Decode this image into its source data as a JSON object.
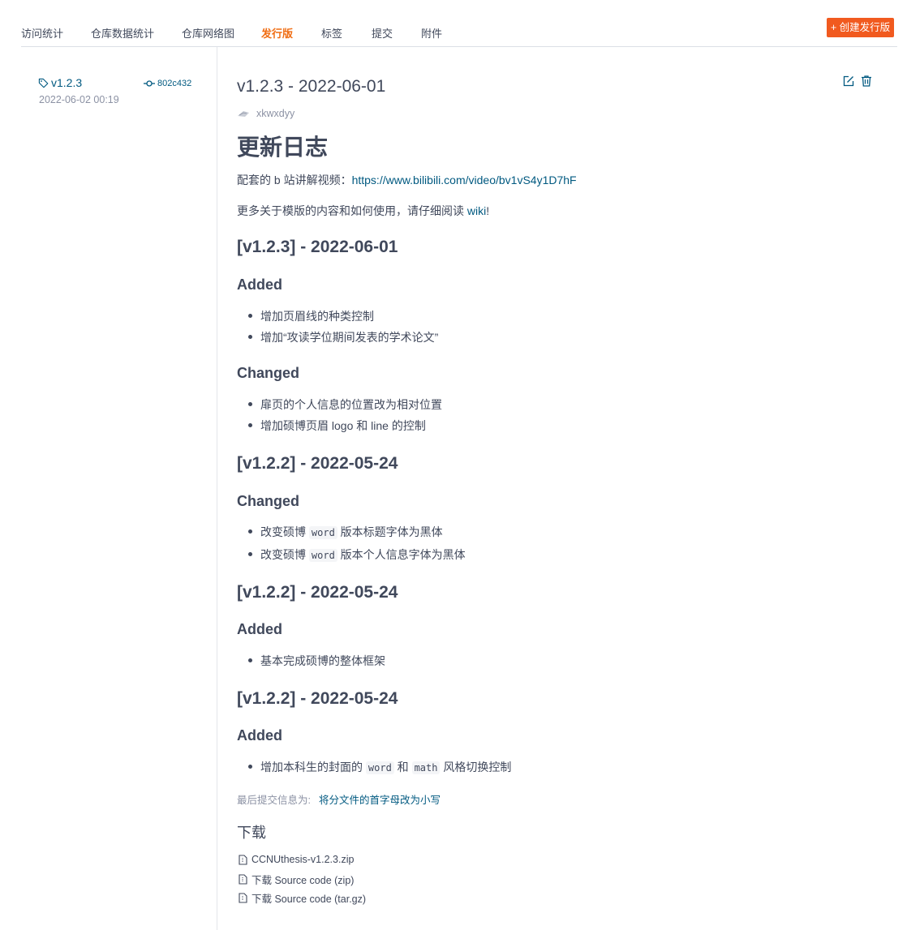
{
  "nav": {
    "tabs": [
      {
        "label": "访问统计"
      },
      {
        "label": "仓库数据统计"
      },
      {
        "label": "仓库网络图"
      },
      {
        "label": "发行版"
      },
      {
        "label": "标签"
      },
      {
        "label": "提交"
      },
      {
        "label": "附件"
      }
    ],
    "active_tab": "发行版",
    "create_button": "+ 创建发行版"
  },
  "sidebar": {
    "tag": "v1.2.3",
    "commit": "802c432",
    "date": "2022-06-02 00:19"
  },
  "release": {
    "title": "v1.2.3 - 2022-06-01",
    "author": "xkwxdyy",
    "heading": "更新日志",
    "video_prefix": "配套的 b 站讲解视频：",
    "video_link": "https://www.bilibili.com/video/bv1vS4y1D7hF",
    "wiki_prefix": "更多关于模版的内容和如何使用，请仔细阅读 ",
    "wiki_link": "wiki",
    "wiki_suffix": "!",
    "sections": [
      {
        "version": "[v1.2.3] - 2022-06-01",
        "groups": [
          {
            "name": "Added",
            "items": [
              "增加页眉线的种类控制",
              "增加“攻读学位期间发表的学术论文”"
            ]
          },
          {
            "name": "Changed",
            "items": [
              "扉页的个人信息的位置改为相对位置",
              "增加硕博页眉 logo 和 line 的控制"
            ]
          }
        ]
      },
      {
        "version": "[v1.2.2] - 2022-05-24",
        "groups": [
          {
            "name": "Changed",
            "items": [
              {
                "pre": "改变硕博 ",
                "code": "word",
                "post": " 版本标题字体为黑体"
              },
              {
                "pre": "改变硕博 ",
                "code": "word",
                "post": " 版本个人信息字体为黑体"
              }
            ]
          }
        ]
      },
      {
        "version": "[v1.2.2] - 2022-05-24",
        "groups": [
          {
            "name": "Added",
            "items": [
              "基本完成硕博的整体框架"
            ]
          }
        ]
      },
      {
        "version": "[v1.2.2] - 2022-05-24",
        "groups": [
          {
            "name": "Added",
            "items": [
              {
                "pre": "增加本科生的封面的 ",
                "code": "word",
                "mid": " 和 ",
                "code2": "math",
                "post": " 风格切换控制"
              }
            ]
          }
        ]
      }
    ],
    "last_commit_label": "最后提交信息为:",
    "last_commit_msg": "将分文件的首字母改为小写",
    "downloads_title": "下载",
    "downloads": [
      "CCNUthesis-v1.2.3.zip",
      "下载 Source code (zip)",
      "下载 Source code (tar.gz)"
    ]
  },
  "colors": {
    "accent": "#f06d13",
    "button": "#f15a1f",
    "link": "#005980",
    "text": "#40485b",
    "muted": "#8c92a4"
  }
}
